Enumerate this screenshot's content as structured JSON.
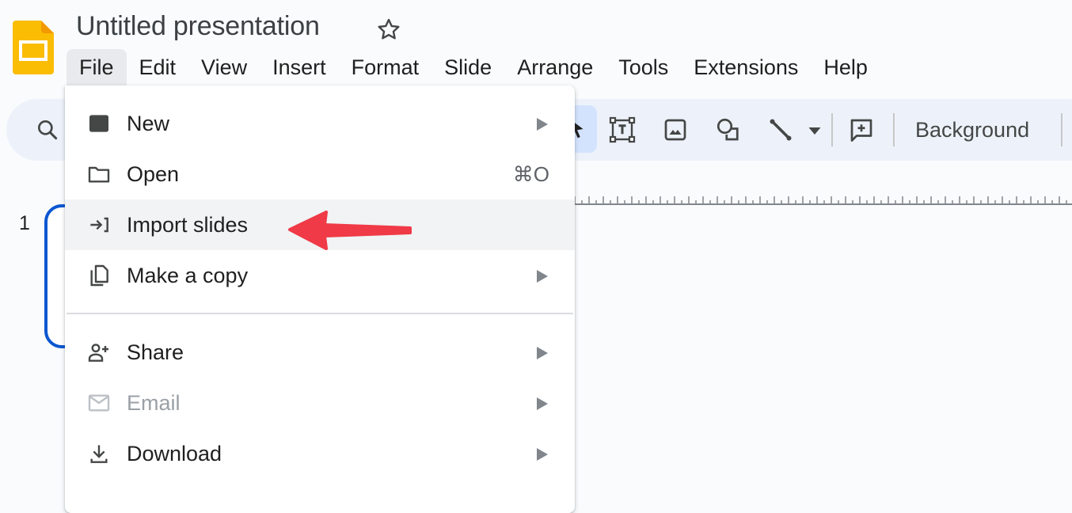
{
  "app": {
    "title": "Untitled presentation",
    "logo_icon": "google-slides-logo",
    "logo_color": "#fbbc04"
  },
  "menubar": {
    "items": [
      {
        "label": "File",
        "active": true
      },
      {
        "label": "Edit"
      },
      {
        "label": "View"
      },
      {
        "label": "Insert"
      },
      {
        "label": "Format"
      },
      {
        "label": "Slide"
      },
      {
        "label": "Arrange"
      },
      {
        "label": "Tools"
      },
      {
        "label": "Extensions"
      },
      {
        "label": "Help"
      }
    ]
  },
  "toolbar": {
    "icons": [
      "search-icon",
      "select-cursor-icon",
      "text-box-icon",
      "image-icon",
      "shape-icon",
      "line-icon",
      "dropdown-arrow-icon",
      "add-comment-icon"
    ],
    "background_label": "Background",
    "accent": "#d3e3fd"
  },
  "filmstrip": {
    "slide_number": "1",
    "selected_color": "#0b57d0"
  },
  "file_menu": {
    "items": [
      {
        "label": "New",
        "icon": "new-presentation-icon",
        "submenu": true
      },
      {
        "label": "Open",
        "icon": "folder-icon",
        "shortcut": "⌘O"
      },
      {
        "label": "Import slides",
        "icon": "import-icon",
        "highlighted": true
      },
      {
        "label": "Make a copy",
        "icon": "copy-icon",
        "submenu": true
      },
      {
        "label": "Share",
        "icon": "person-add-icon",
        "submenu": true
      },
      {
        "label": "Email",
        "icon": "email-icon",
        "submenu": true,
        "disabled": true
      },
      {
        "label": "Download",
        "icon": "download-icon",
        "submenu": true
      }
    ]
  },
  "annotation": {
    "type": "red-arrow",
    "points_to": "Import slides",
    "color": "#f03a47"
  }
}
